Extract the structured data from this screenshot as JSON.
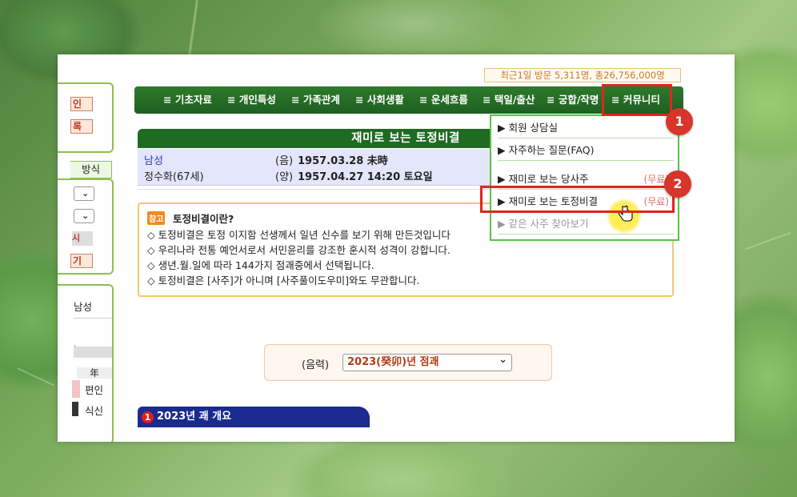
{
  "sidebar": {
    "btn1": "인",
    "btn2": "록",
    "method_tab": "방식",
    "btn_red": "시",
    "btn_open": "기",
    "gender": "남성",
    "paren": ")",
    "year_label": "年",
    "ten_god1": "편인",
    "ten_god2": "식신"
  },
  "header": {
    "visitors": "최근1일 방문 5,311명, 총26,756,000명"
  },
  "nav": {
    "items": [
      "≡ 기초자료",
      "≡ 개인특성",
      "≡ 가족관계",
      "≡ 사회생활",
      "≡ 운세흐름",
      "≡ 택일/출산",
      "≡ 궁합/작명",
      "≡ 커뮤니티"
    ]
  },
  "page": {
    "title": "재미로 보는 토정비결",
    "gender": "남성",
    "name_age": "정수화(67세)",
    "lunar_prefix": "(음)",
    "lunar_date": "1957.03.28 未時",
    "solar_prefix": "(양)",
    "solar_date": "1957.04.27 14:20 토요일"
  },
  "notice": {
    "badge": "참고",
    "heading": "토정비결이란?",
    "line1": "◇ 토정비결은 토정 이지함 선생께서 일년 신수를 보기 위해 만든것입니다",
    "line2": "◇ 우리나라 전통 예언서로서 서민윤리를 강조한 훈시적 성격이 강합니다.",
    "line3": "◇ 생년.월.일에 따라 144가지 점괘중에서 선택됩니다.",
    "line4": "◇ 토정비결은 [사주]가 아니며 [사주풀이도우미]와도 무관합니다."
  },
  "year_select": {
    "label": "(음력)",
    "value": "2023(癸卯)년 점괘",
    "arrow": "⌄"
  },
  "section1": {
    "num": "1",
    "title": "2023년 괘 개요"
  },
  "dropdown": {
    "items": [
      {
        "label": "▶ 회원 상담실",
        "free": ""
      },
      {
        "label": "▶ 자주하는 질문(FAQ)",
        "free": ""
      },
      {
        "label": "▶ 재미로 보는 당사주",
        "free": "(무료)"
      },
      {
        "label": "▶ 재미로 보는 토정비결",
        "free": "(무료)"
      },
      {
        "label": "▶ 같은 사주 찾아보기",
        "free": ""
      }
    ]
  },
  "annotations": {
    "step1": "1",
    "step2": "2",
    "accent_red": "#e0251f",
    "nav_green": "#1f5f20"
  }
}
